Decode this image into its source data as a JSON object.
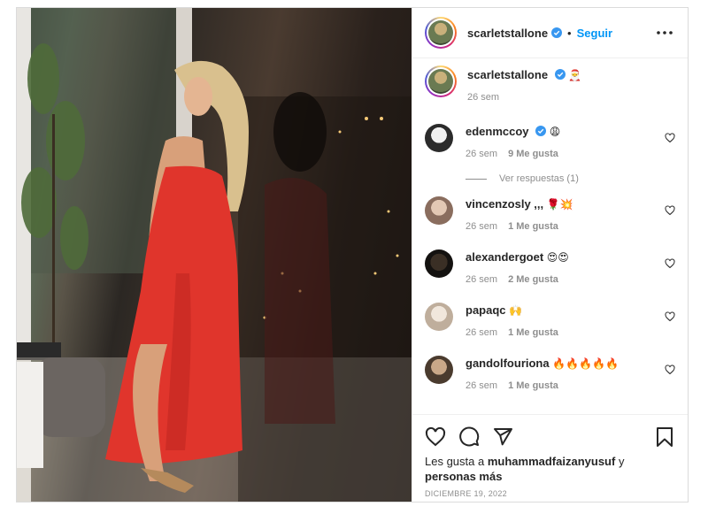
{
  "post": {
    "username": "scarletstallone",
    "follow_label": "Seguir",
    "separator": "•",
    "caption_emoji": "🎅",
    "caption_time": "26 sem"
  },
  "comments": [
    {
      "username": "edenmccoy",
      "verified": true,
      "text": "😩",
      "time": "26 sem",
      "likes": "9 Me gusta",
      "avatar_color": "#2b2b2b"
    },
    {
      "username": "vincenzosly ,,,",
      "verified": false,
      "text": "🌹💥",
      "time": "26 sem",
      "likes": "1 Me gusta",
      "avatar_color": "#9c7a6a"
    },
    {
      "username": "alexandergoet",
      "verified": false,
      "text": "😍😍",
      "time": "26 sem",
      "likes": "2 Me gusta",
      "avatar_color": "#1e1a16"
    },
    {
      "username": "papaqc",
      "verified": false,
      "text": "🙌",
      "time": "26 sem",
      "likes": "1 Me gusta",
      "avatar_color": "#d9c9b8"
    },
    {
      "username": "gandolfouriona",
      "verified": false,
      "text": "🔥🔥🔥🔥🔥",
      "time": "26 sem",
      "likes": "1 Me gusta",
      "avatar_color": "#5a4a3a"
    }
  ],
  "replies_label": "Ver respuestas (1)",
  "footer": {
    "liked_prefix": "Les gusta a",
    "liked_user": "muhammadfaizanyusuf",
    "liked_middle": "y",
    "liked_suffix": "personas más",
    "date": "DICIEMBRE 19, 2022"
  },
  "icons": {
    "more": "more-horizontal-icon",
    "verified": "verified-badge-icon",
    "heart": "heart-icon",
    "comment": "comment-icon",
    "share": "share-icon",
    "bookmark": "bookmark-icon"
  },
  "colors": {
    "accent": "#0095f6",
    "verified": "#3897f0",
    "muted": "#8e8e8e",
    "dress": "#e0352c"
  }
}
